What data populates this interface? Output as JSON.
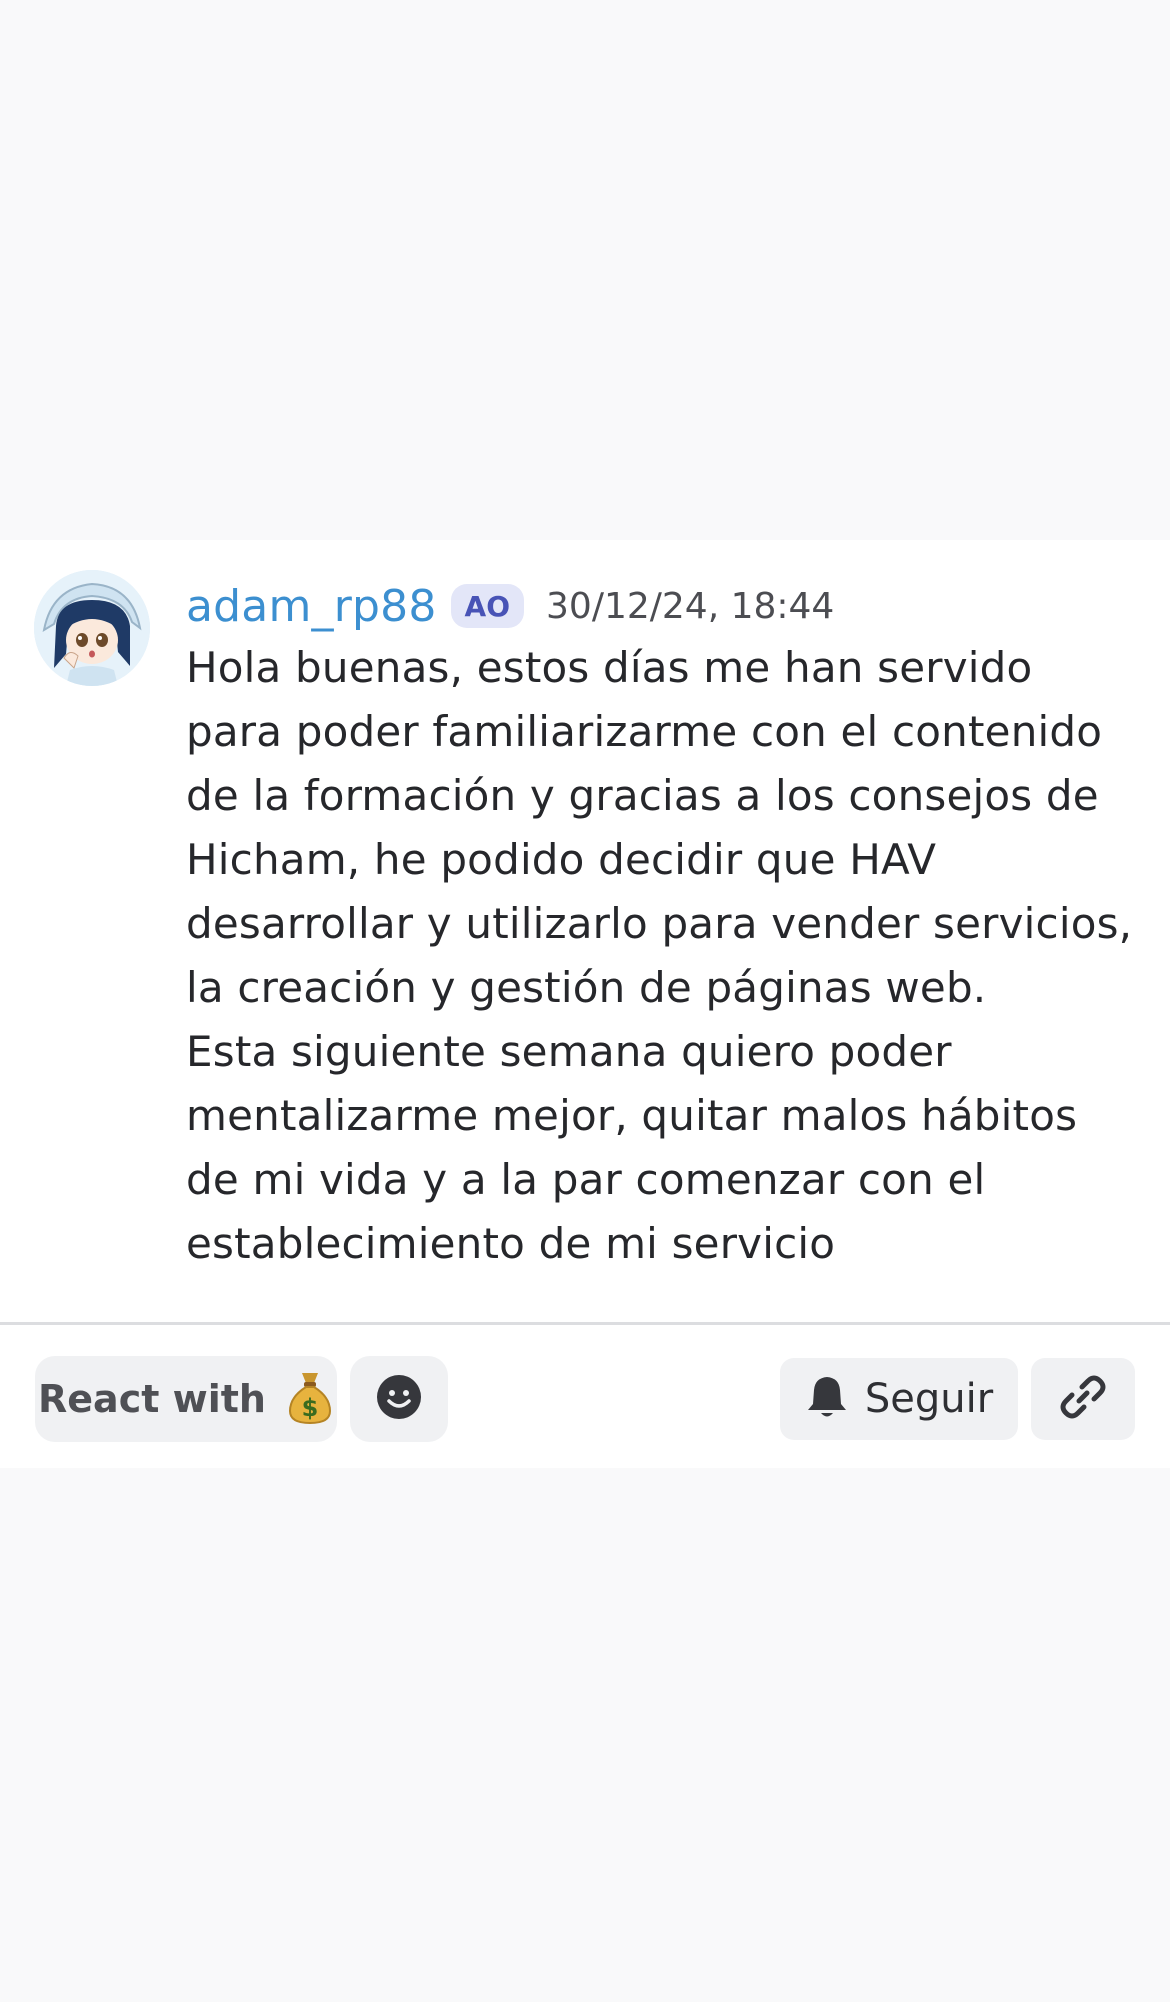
{
  "message": {
    "username": "adam_rp88",
    "tag": "AO",
    "timestamp": "30/12/24, 18:44",
    "body": "Hola buenas, estos días me han servido para poder familiarizarme con el contenido de la formación y gracias a los consejos de Hicham, he podido decidir que HAV desarrollar y utilizarlo para vender servicios, la creación y gestión de páginas web.\nEsta siguiente semana quiero poder mentalizarme mejor, quitar malos hábitos de mi vida y a la par comenzar con el establecimiento de mi servicio"
  },
  "actions": {
    "react_label": "React with",
    "react_emoji": "💰",
    "follow_label": "Seguir"
  },
  "colors": {
    "username": "#3c8fd0",
    "tag_bg": "#e3e6f8",
    "tag_text": "#4853b6",
    "button_bg": "#f0f1f3",
    "page_bg": "#f9f9fa"
  },
  "icons": {
    "react_emoji": "money-bag-icon",
    "emoji_picker": "smiley-face-icon",
    "follow": "bell-icon",
    "link": "link-icon"
  }
}
